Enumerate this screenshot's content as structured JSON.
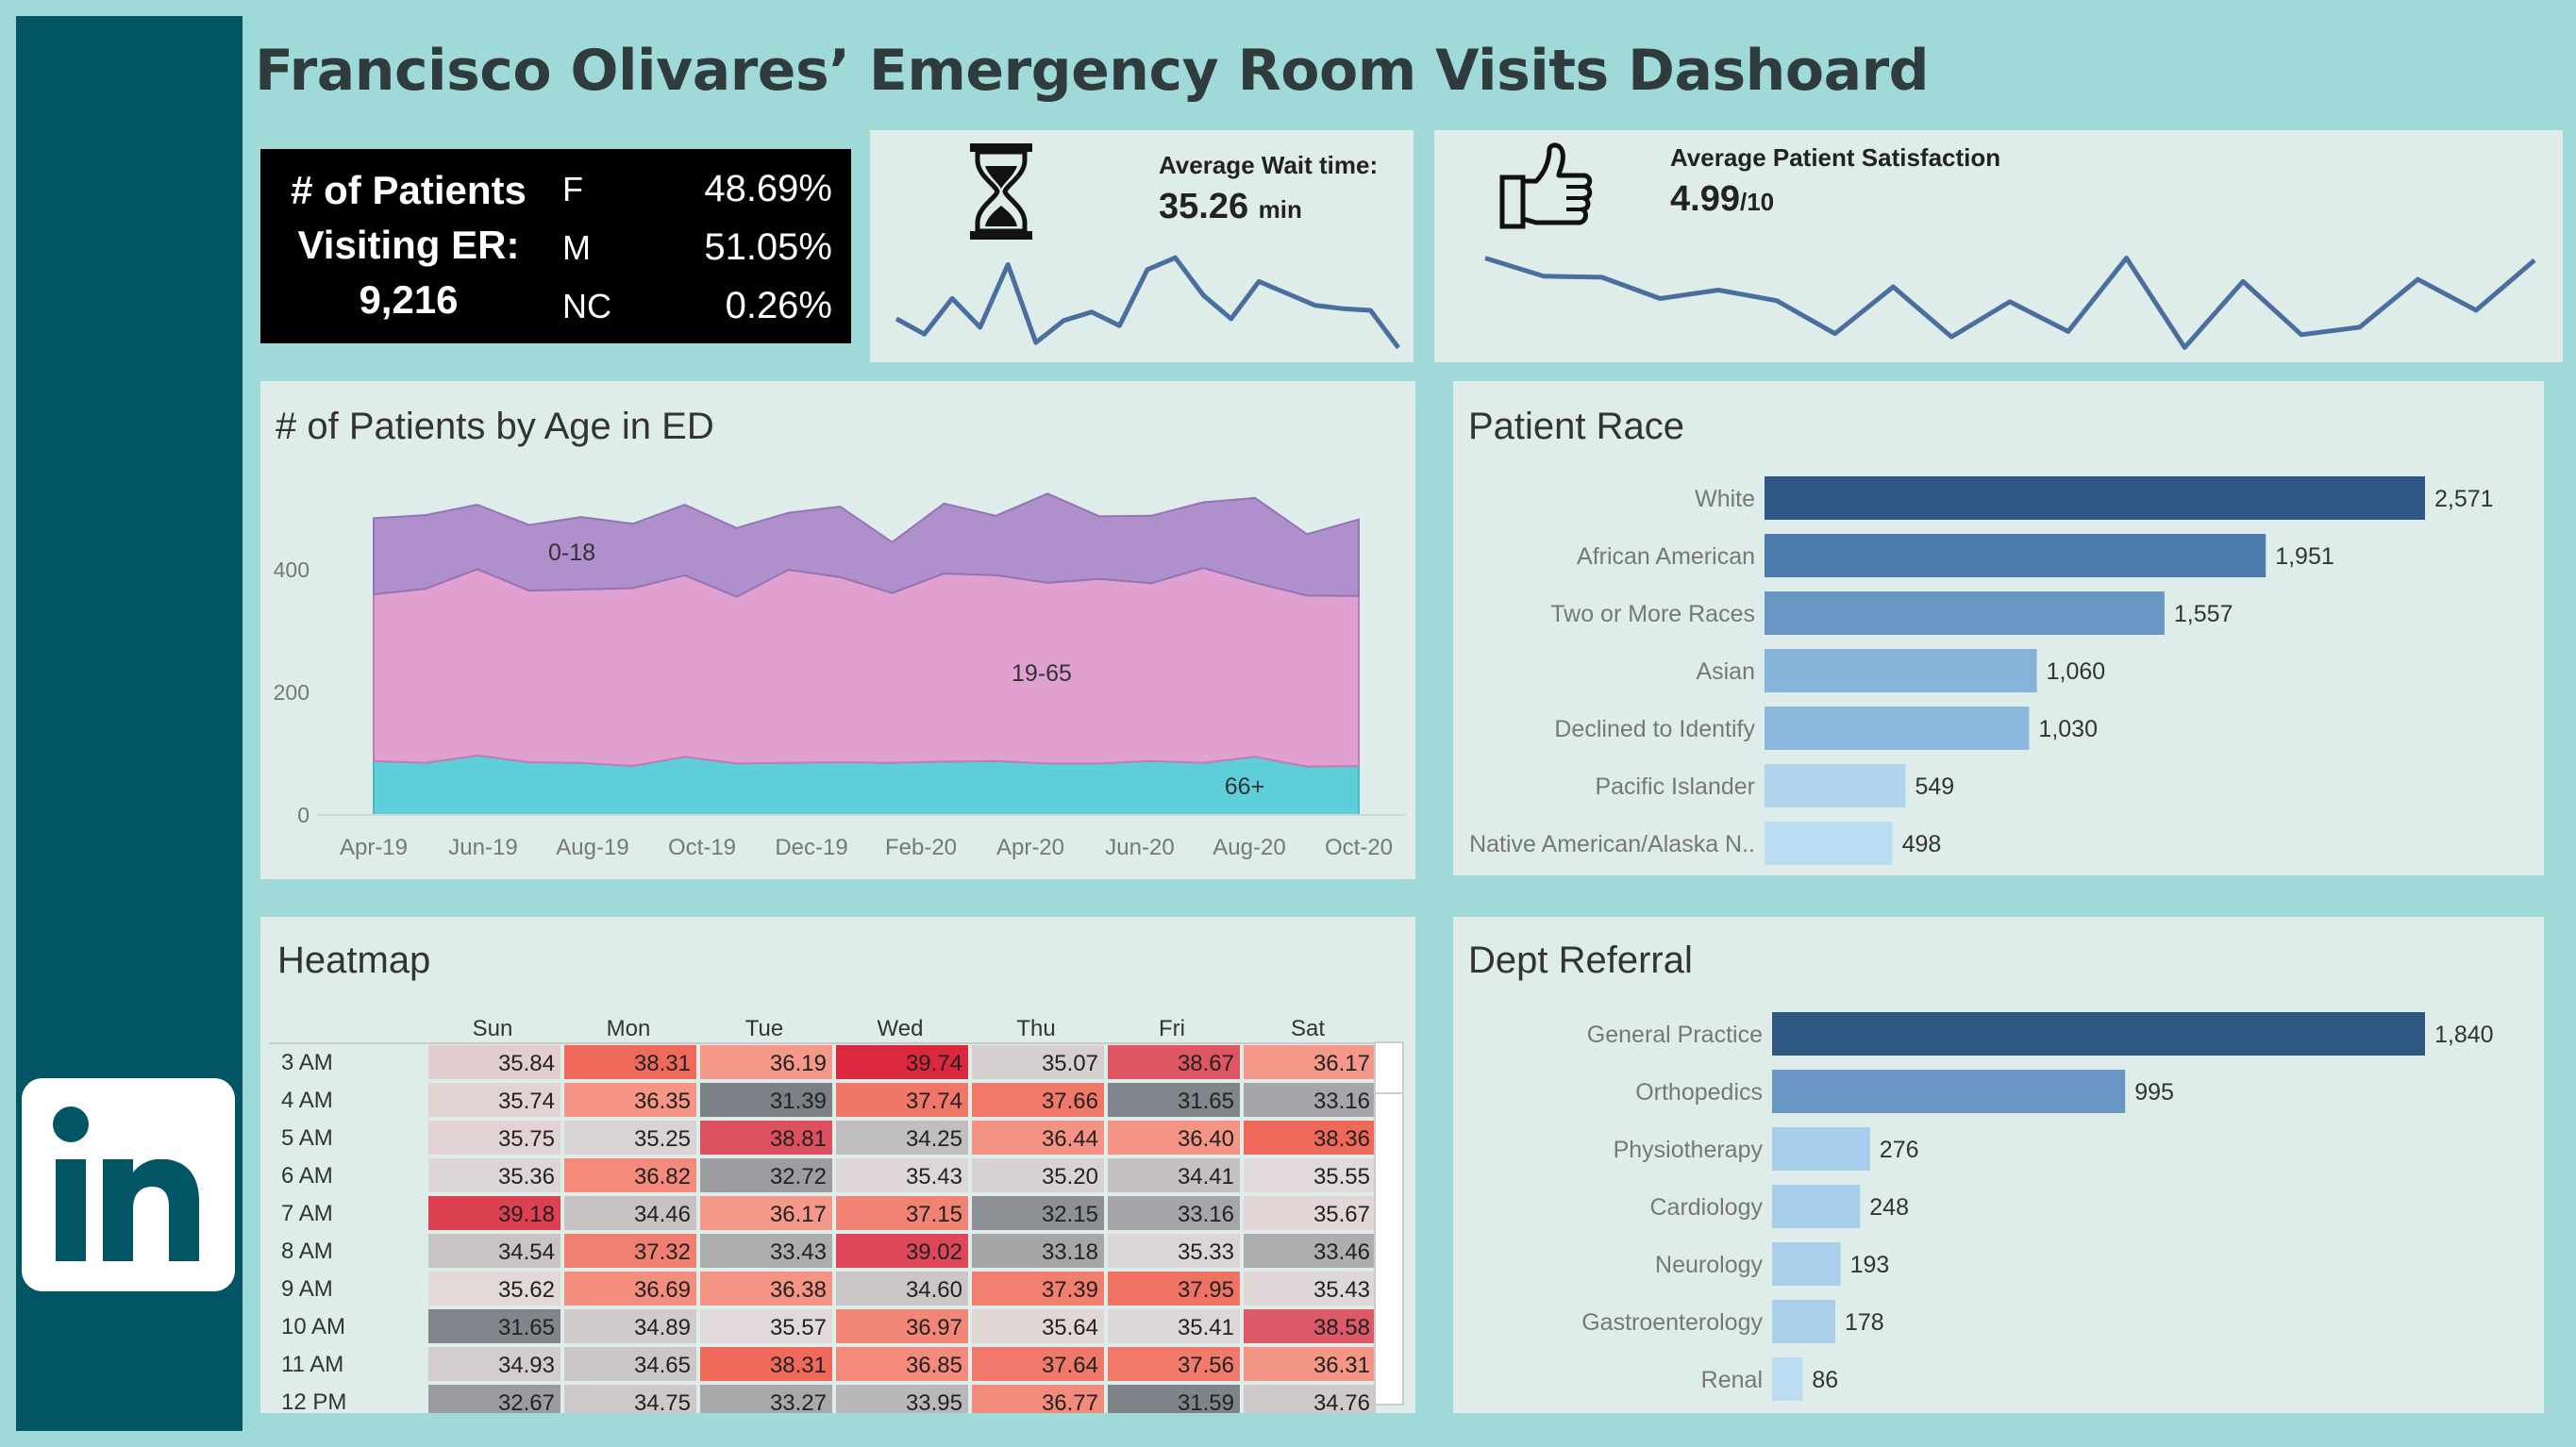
{
  "title": "Francisco Olivares’ Emergency Room Visits Dashoard",
  "colors": {
    "background": "#9fdad8",
    "sidebar": "#015565",
    "panel": "#deede9",
    "line": "#4a6f9f"
  },
  "icons": {
    "linkedin": "linkedin-icon",
    "hourglass": "hourglass-icon",
    "thumbs_up": "thumbs-up-icon"
  },
  "patients_kpi": {
    "label_line1": "# of Patients",
    "label_line2": "Visiting ER:",
    "total": "9,216",
    "genders": [
      {
        "label": "F",
        "value": "48.69%"
      },
      {
        "label": "M",
        "value": "51.05%"
      },
      {
        "label": "NC",
        "value": "0.26%"
      }
    ]
  },
  "wait_time": {
    "title": "Average Wait time:",
    "value": "35.26",
    "unit": "min",
    "trend": [
      36.0,
      35.1,
      37.2,
      35.5,
      39.2,
      34.6,
      35.9,
      36.4,
      35.6,
      38.9,
      39.6,
      37.4,
      36.0,
      38.2,
      37.5,
      36.8,
      36.6,
      36.5,
      34.3
    ]
  },
  "satisfaction": {
    "title": "Average Patient Satisfaction",
    "value": "4.99",
    "unit": "/10",
    "trend": [
      5.25,
      5.08,
      5.07,
      4.87,
      4.95,
      4.85,
      4.54,
      4.98,
      4.51,
      4.84,
      4.56,
      5.25,
      4.41,
      5.03,
      4.53,
      4.6,
      5.05,
      4.76,
      5.23
    ]
  },
  "age_chart": {
    "title": "# of Patients by Age in ED",
    "chart_data": {
      "type": "area",
      "x_ticks": [
        "Apr-19",
        "Jun-19",
        "Aug-19",
        "Oct-19",
        "Dec-19",
        "Feb-20",
        "Apr-20",
        "Jun-20",
        "Aug-20",
        "Oct-20"
      ],
      "ylim": [
        0,
        520
      ],
      "y_ticks": [
        "0",
        "200",
        "400"
      ],
      "series": [
        {
          "name": "66+",
          "values": [
            88,
            85,
            97,
            86,
            85,
            80,
            95,
            84,
            85,
            86,
            85,
            87,
            88,
            84,
            84,
            88,
            85,
            95,
            79,
            80
          ]
        },
        {
          "name": "19-65",
          "values": [
            272,
            284,
            304,
            280,
            283,
            290,
            296,
            272,
            315,
            302,
            277,
            307,
            303,
            295,
            301,
            290,
            318,
            284,
            279,
            277
          ]
        },
        {
          "name": "0-18",
          "values": [
            124,
            120,
            105,
            107,
            118,
            105,
            115,
            112,
            93,
            115,
            83,
            114,
            97,
            145,
            102,
            110,
            107,
            138,
            100,
            125
          ]
        }
      ]
    }
  },
  "race_chart": {
    "title": "Patient Race",
    "chart_data": {
      "type": "bar",
      "categories": [
        "White",
        "African American",
        "Two or More Races",
        "Asian",
        "Declined to Identify",
        "Pacific Islander",
        "Native American/Alaska N.."
      ],
      "values": [
        2571,
        1951,
        1557,
        1060,
        1030,
        549,
        498
      ],
      "labels": [
        "2,571",
        "1,951",
        "1,557",
        "1,060",
        "1,030",
        "549",
        "498"
      ],
      "colors": [
        "#2e5784",
        "#4c7cae",
        "#6897c4",
        "#85b3da",
        "#8cb8de",
        "#b1d5ee",
        "#bcdcf1"
      ]
    }
  },
  "heatmap": {
    "title": "Heatmap",
    "chart_data": {
      "type": "heatmap",
      "columns": [
        "Sun",
        "Mon",
        "Tue",
        "Wed",
        "Thu",
        "Fri",
        "Sat"
      ],
      "rows": [
        "3 AM",
        "4 AM",
        "5 AM",
        "6 AM",
        "7 AM",
        "8 AM",
        "9 AM",
        "10 AM",
        "11 AM",
        "12 PM"
      ],
      "values": [
        [
          "35.84",
          "38.31",
          "36.19",
          "39.74",
          "35.07",
          "38.67",
          "36.17"
        ],
        [
          "35.74",
          "36.35",
          "31.39",
          "37.74",
          "37.66",
          "31.65",
          "33.16"
        ],
        [
          "35.75",
          "35.25",
          "38.81",
          "34.25",
          "36.44",
          "36.40",
          "38.36"
        ],
        [
          "35.36",
          "36.82",
          "32.72",
          "35.43",
          "35.20",
          "34.41",
          "35.55"
        ],
        [
          "39.18",
          "34.46",
          "36.17",
          "37.15",
          "32.15",
          "33.16",
          "35.67"
        ],
        [
          "34.54",
          "37.32",
          "33.43",
          "39.02",
          "33.18",
          "35.33",
          "33.46"
        ],
        [
          "35.62",
          "36.69",
          "36.38",
          "34.60",
          "37.39",
          "37.95",
          "35.43"
        ],
        [
          "31.65",
          "34.89",
          "35.57",
          "36.97",
          "35.64",
          "35.41",
          "38.58"
        ],
        [
          "34.93",
          "34.65",
          "38.31",
          "36.85",
          "37.64",
          "37.56",
          "36.31"
        ],
        [
          "32.67",
          "34.75",
          "33.27",
          "33.95",
          "36.77",
          "31.59",
          "34.76"
        ]
      ]
    }
  },
  "referral_chart": {
    "title": "Dept Referral",
    "chart_data": {
      "type": "bar",
      "categories": [
        "General Practice",
        "Orthopedics",
        "Physiotherapy",
        "Cardiology",
        "Neurology",
        "Gastroenterology",
        "Renal"
      ],
      "values": [
        1840,
        995,
        276,
        248,
        193,
        178,
        86
      ],
      "labels": [
        "1,840",
        "995",
        "276",
        "248",
        "193",
        "178",
        "86"
      ],
      "colors": [
        "#2e5784",
        "#6897c4",
        "#a6cdea",
        "#a6cdea",
        "#a9cfeb",
        "#a9cfeb",
        "#bcdcf1"
      ]
    }
  }
}
